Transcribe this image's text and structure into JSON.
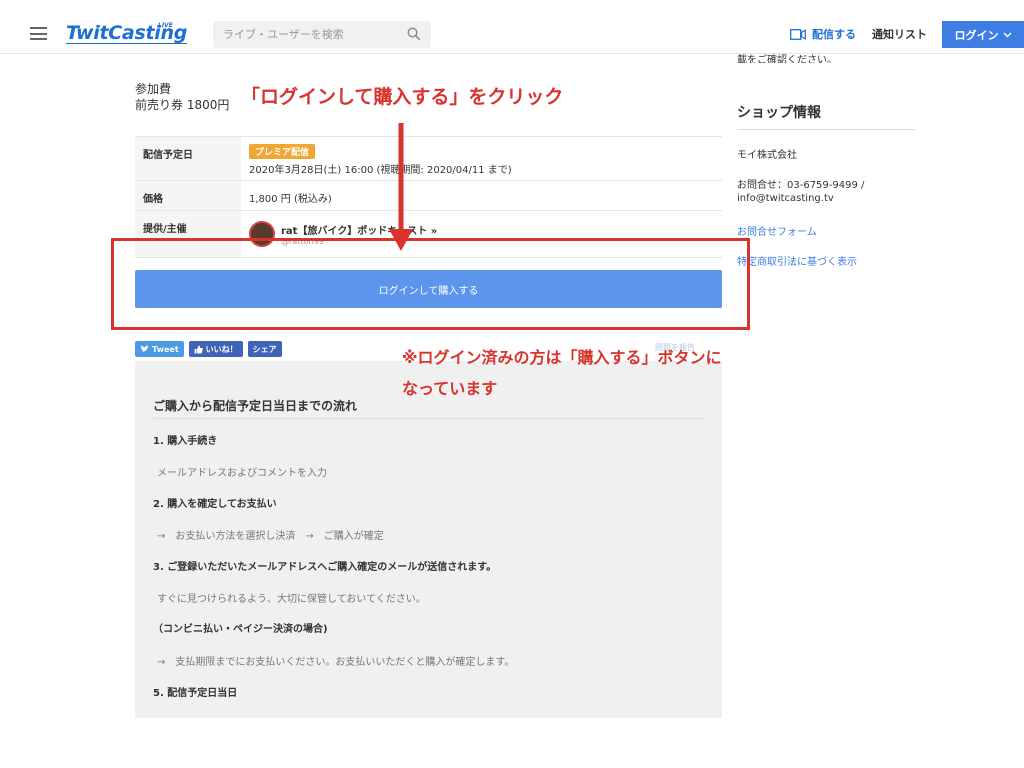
{
  "header": {
    "logo": "TwitCasting",
    "logo_badge": "LIVE",
    "search_placeholder": "ライブ・ユーザーを検索",
    "broadcast_label": "配信する",
    "notify_label": "通知リスト",
    "login_label": "ログイン",
    "accent_color": "#3d7de4"
  },
  "ticket": {
    "fee_label": "参加費",
    "fee_value": "前売り券 1800円"
  },
  "table": {
    "rows": [
      {
        "key": "配信予定日",
        "badge": "プレミア配信",
        "value": "2020年3月28日(土) 16:00 (視聴期間: 2020/04/11 まで)"
      },
      {
        "key": "価格",
        "value": "1,800 円 (税込み)"
      },
      {
        "key": "提供/主催",
        "provider_name": "rat【旅バイク】ポッドキャスト »",
        "provider_id": "@rattori99"
      }
    ]
  },
  "buy_button": "ログインして購入する",
  "share": {
    "tweet": "Tweet",
    "like": "いいね！",
    "share": "シェア",
    "report": "問題を報告"
  },
  "flow": {
    "title": "ご購入から配信予定日当日までの流れ",
    "steps": [
      {
        "heading": "1. 購入手続き",
        "text": "メールアドレスおよびコメントを入力"
      },
      {
        "heading": "2. 購入を確定してお支払い",
        "text": "→　お支払い方法を選択し決済　→　ご購入が確定"
      },
      {
        "heading": "3. ご登録いただいたメールアドレスへご購入確定のメールが送信されます。",
        "text": "すぐに見つけられるよう、大切に保管しておいてください。"
      },
      {
        "heading": "（コンビニ払い・ペイジー決済の場合)",
        "text": "→　支払期限までにお支払いください。お支払いいただくと購入が確定します。"
      },
      {
        "heading": "5. 配信予定日当日",
        "text": ""
      }
    ]
  },
  "sidebar": {
    "cut_text": "載をご確認ください。",
    "shop_title": "ショップ情報",
    "company": "モイ株式会社",
    "contact_line1": "お問合せ：03-6759-9499 /",
    "contact_line2": "info@twitcasting.tv",
    "contact_form": "お問合せフォーム",
    "tokusho": "特定商取引法に基づく表示"
  },
  "annotations": {
    "top": "「ログインして購入する」をクリック",
    "bottom_line1": "※ログイン済みの方は「購入する」ボタンに",
    "bottom_line2": "なっています",
    "color": "#d8332c"
  }
}
